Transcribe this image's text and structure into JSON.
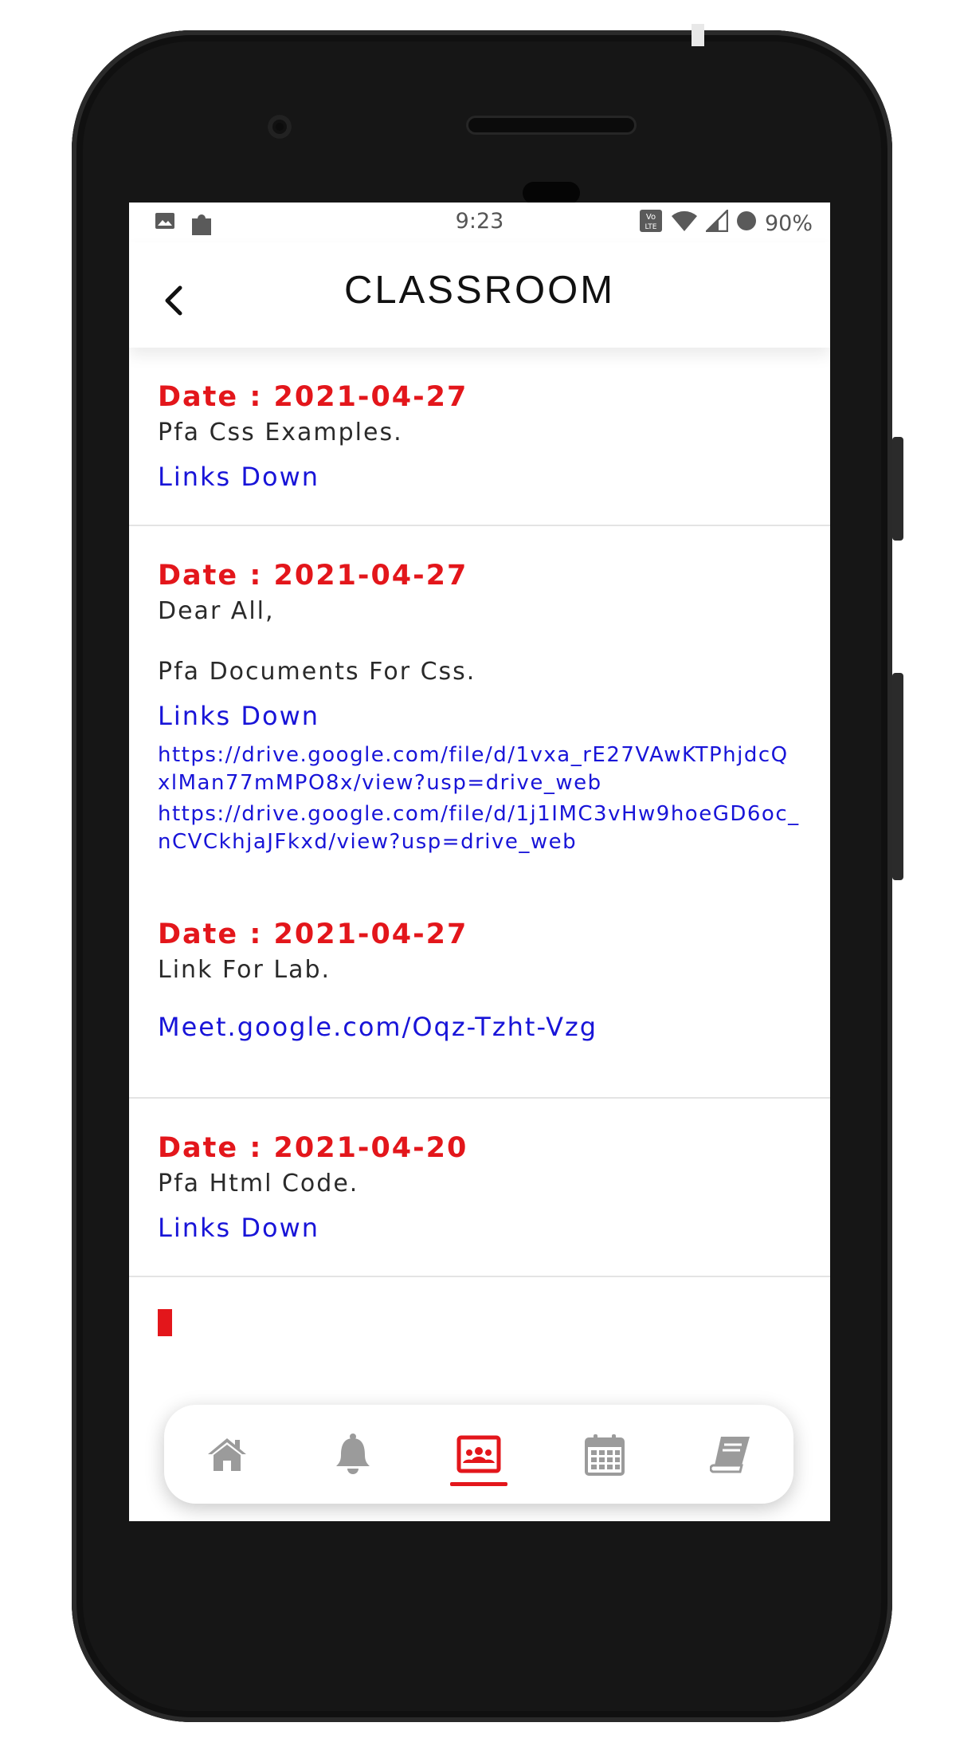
{
  "status_bar": {
    "time": "9:23",
    "battery": "90%",
    "left_icons": [
      "image-icon",
      "puzzle-icon"
    ],
    "right_icons": [
      "volte-icon",
      "wifi-icon",
      "signal-icon",
      "battery-icon"
    ]
  },
  "app_bar": {
    "title": "CLASSROOM",
    "back_icon": "chevron-left-icon"
  },
  "posts": [
    {
      "date": "Date : 2021-04-27",
      "body": "Pfa Css Examples.",
      "action": "Links Down"
    },
    {
      "date": "Date : 2021-04-27",
      "body": "Dear All,\n\nPfa Documents For Css.",
      "action": "Links Down",
      "urls": [
        "https://drive.google.com/file/d/1vxa_rE27VAwKTPhjdcQxlMan77mMPO8x/view?usp=drive_web",
        "https://drive.google.com/file/d/1j1IMC3vHw9hoeGD6oc_nCVCkhjaJFkxd/view?usp=drive_web"
      ]
    },
    {
      "date": "Date : 2021-04-27",
      "body": "Link For Lab.",
      "action": "Meet.google.com/Oqz-Tzht-Vzg"
    },
    {
      "date": "Date : 2021-04-20",
      "body": "Pfa Html Code.",
      "action": "Links Down"
    }
  ],
  "bottom_nav": {
    "items": [
      {
        "icon": "home-icon",
        "active": false
      },
      {
        "icon": "bell-icon",
        "active": false
      },
      {
        "icon": "classroom-icon",
        "active": true
      },
      {
        "icon": "calendar-icon",
        "active": false
      },
      {
        "icon": "book-icon",
        "active": false
      }
    ]
  },
  "colors": {
    "accent": "#e3161b",
    "link": "#1814d8",
    "inactive_icon": "#9b9b9b"
  }
}
